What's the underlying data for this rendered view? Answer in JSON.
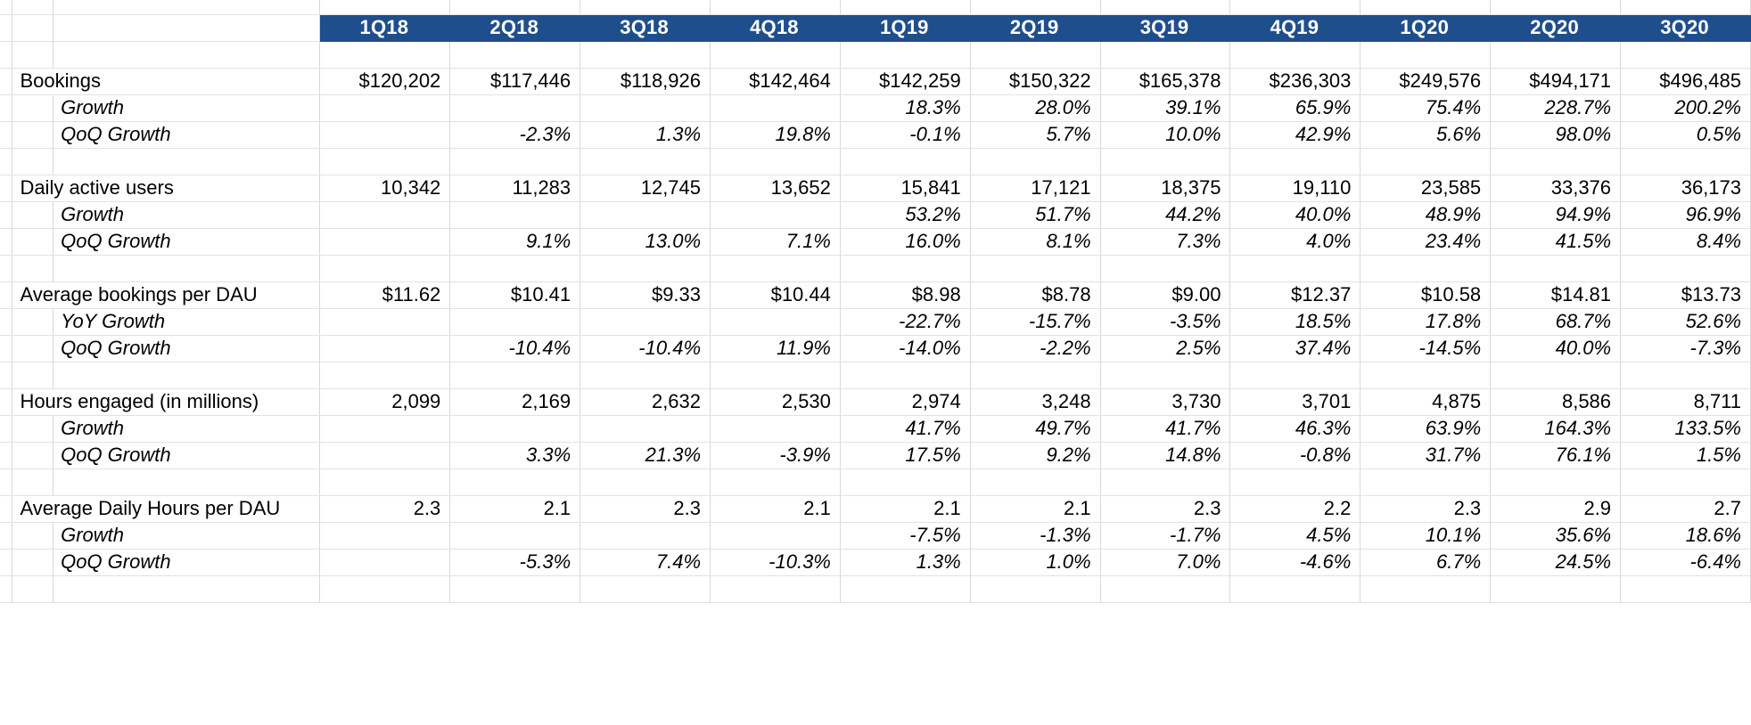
{
  "header": {
    "blank_label": "",
    "columns": [
      "1Q18",
      "2Q18",
      "3Q18",
      "4Q18",
      "1Q19",
      "2Q19",
      "3Q19",
      "4Q19",
      "1Q20",
      "2Q20",
      "3Q20"
    ],
    "background_color": "#1F4E8C",
    "text_color": "#FFFFFF"
  },
  "grid": {
    "line_color": "#D9D9D9",
    "background": "#FFFFFF"
  },
  "chart_data": {
    "type": "table",
    "title": "",
    "categories": [
      "1Q18",
      "2Q18",
      "3Q18",
      "4Q18",
      "1Q19",
      "2Q19",
      "3Q19",
      "4Q19",
      "1Q20",
      "2Q20",
      "3Q20"
    ],
    "series": [
      {
        "name": "Bookings",
        "values": [
          "$120,202",
          "$117,446",
          "$118,926",
          "$142,464",
          "$142,259",
          "$150,322",
          "$165,378",
          "$236,303",
          "$249,576",
          "$494,171",
          "$496,485"
        ]
      },
      {
        "name": "Bookings Growth",
        "values": [
          "",
          "",
          "",
          "",
          "18.3%",
          "28.0%",
          "39.1%",
          "65.9%",
          "75.4%",
          "228.7%",
          "200.2%"
        ]
      },
      {
        "name": "Bookings QoQ Growth",
        "values": [
          "",
          "-2.3%",
          "1.3%",
          "19.8%",
          "-0.1%",
          "5.7%",
          "10.0%",
          "42.9%",
          "5.6%",
          "98.0%",
          "0.5%"
        ]
      },
      {
        "name": "Daily active users",
        "values": [
          "10,342",
          "11,283",
          "12,745",
          "13,652",
          "15,841",
          "17,121",
          "18,375",
          "19,110",
          "23,585",
          "33,376",
          "36,173"
        ]
      },
      {
        "name": "Daily active users Growth",
        "values": [
          "",
          "",
          "",
          "",
          "53.2%",
          "51.7%",
          "44.2%",
          "40.0%",
          "48.9%",
          "94.9%",
          "96.9%"
        ]
      },
      {
        "name": "Daily active users QoQ Growth",
        "values": [
          "",
          "9.1%",
          "13.0%",
          "7.1%",
          "16.0%",
          "8.1%",
          "7.3%",
          "4.0%",
          "23.4%",
          "41.5%",
          "8.4%"
        ]
      },
      {
        "name": "Average bookings per DAU",
        "values": [
          "$11.62",
          "$10.41",
          "$9.33",
          "$10.44",
          "$8.98",
          "$8.78",
          "$9.00",
          "$12.37",
          "$10.58",
          "$14.81",
          "$13.73"
        ]
      },
      {
        "name": "Average bookings per DAU YoY Growth",
        "values": [
          "",
          "",
          "",
          "",
          "-22.7%",
          "-15.7%",
          "-3.5%",
          "18.5%",
          "17.8%",
          "68.7%",
          "52.6%"
        ]
      },
      {
        "name": "Average bookings per DAU QoQ Growth",
        "values": [
          "",
          "-10.4%",
          "-10.4%",
          "11.9%",
          "-14.0%",
          "-2.2%",
          "2.5%",
          "37.4%",
          "-14.5%",
          "40.0%",
          "-7.3%"
        ]
      },
      {
        "name": "Hours engaged (in millions)",
        "values": [
          "2,099",
          "2,169",
          "2,632",
          "2,530",
          "2,974",
          "3,248",
          "3,730",
          "3,701",
          "4,875",
          "8,586",
          "8,711"
        ]
      },
      {
        "name": "Hours engaged Growth",
        "values": [
          "",
          "",
          "",
          "",
          "41.7%",
          "49.7%",
          "41.7%",
          "46.3%",
          "63.9%",
          "164.3%",
          "133.5%"
        ]
      },
      {
        "name": "Hours engaged QoQ Growth",
        "values": [
          "",
          "3.3%",
          "21.3%",
          "-3.9%",
          "17.5%",
          "9.2%",
          "14.8%",
          "-0.8%",
          "31.7%",
          "76.1%",
          "1.5%"
        ]
      },
      {
        "name": "Average Daily Hours per DAU",
        "values": [
          "2.3",
          "2.1",
          "2.3",
          "2.1",
          "2.1",
          "2.1",
          "2.3",
          "2.2",
          "2.3",
          "2.9",
          "2.7"
        ]
      },
      {
        "name": "Average Daily Hours per DAU Growth",
        "values": [
          "",
          "",
          "",
          "",
          "-7.5%",
          "-1.3%",
          "-1.7%",
          "4.5%",
          "10.1%",
          "35.6%",
          "18.6%"
        ]
      },
      {
        "name": "Average Daily Hours per DAU QoQ Growth",
        "values": [
          "",
          "-5.3%",
          "7.4%",
          "-10.3%",
          "1.3%",
          "1.0%",
          "7.0%",
          "-4.6%",
          "6.7%",
          "24.5%",
          "-6.4%"
        ]
      }
    ]
  },
  "rows": [
    {
      "kind": "spacer"
    },
    {
      "kind": "main",
      "label": "Bookings",
      "values": [
        "$120,202",
        "$117,446",
        "$118,926",
        "$142,464",
        "$142,259",
        "$150,322",
        "$165,378",
        "$236,303",
        "$249,576",
        "$494,171",
        "$496,485"
      ]
    },
    {
      "kind": "sub",
      "label": "Growth",
      "values": [
        "",
        "",
        "",
        "",
        "18.3%",
        "28.0%",
        "39.1%",
        "65.9%",
        "75.4%",
        "228.7%",
        "200.2%"
      ]
    },
    {
      "kind": "sub",
      "label": "QoQ Growth",
      "values": [
        "",
        "-2.3%",
        "1.3%",
        "19.8%",
        "-0.1%",
        "5.7%",
        "10.0%",
        "42.9%",
        "5.6%",
        "98.0%",
        "0.5%"
      ]
    },
    {
      "kind": "spacer"
    },
    {
      "kind": "main",
      "label": "Daily active users",
      "values": [
        "10,342",
        "11,283",
        "12,745",
        "13,652",
        "15,841",
        "17,121",
        "18,375",
        "19,110",
        "23,585",
        "33,376",
        "36,173"
      ]
    },
    {
      "kind": "sub",
      "label": "Growth",
      "values": [
        "",
        "",
        "",
        "",
        "53.2%",
        "51.7%",
        "44.2%",
        "40.0%",
        "48.9%",
        "94.9%",
        "96.9%"
      ]
    },
    {
      "kind": "sub",
      "label": "QoQ Growth",
      "values": [
        "",
        "9.1%",
        "13.0%",
        "7.1%",
        "16.0%",
        "8.1%",
        "7.3%",
        "4.0%",
        "23.4%",
        "41.5%",
        "8.4%"
      ]
    },
    {
      "kind": "spacer"
    },
    {
      "kind": "main",
      "label": "Average bookings per DAU",
      "values": [
        "$11.62",
        "$10.41",
        "$9.33",
        "$10.44",
        "$8.98",
        "$8.78",
        "$9.00",
        "$12.37",
        "$10.58",
        "$14.81",
        "$13.73"
      ]
    },
    {
      "kind": "sub",
      "label": "YoY Growth",
      "values": [
        "",
        "",
        "",
        "",
        "-22.7%",
        "-15.7%",
        "-3.5%",
        "18.5%",
        "17.8%",
        "68.7%",
        "52.6%"
      ]
    },
    {
      "kind": "sub",
      "label": "QoQ Growth",
      "values": [
        "",
        "-10.4%",
        "-10.4%",
        "11.9%",
        "-14.0%",
        "-2.2%",
        "2.5%",
        "37.4%",
        "-14.5%",
        "40.0%",
        "-7.3%"
      ]
    },
    {
      "kind": "spacer"
    },
    {
      "kind": "main",
      "label": "Hours engaged (in millions)",
      "values": [
        "2,099",
        "2,169",
        "2,632",
        "2,530",
        "2,974",
        "3,248",
        "3,730",
        "3,701",
        "4,875",
        "8,586",
        "8,711"
      ]
    },
    {
      "kind": "sub",
      "label": "Growth",
      "values": [
        "",
        "",
        "",
        "",
        "41.7%",
        "49.7%",
        "41.7%",
        "46.3%",
        "63.9%",
        "164.3%",
        "133.5%"
      ]
    },
    {
      "kind": "sub",
      "label": "QoQ Growth",
      "values": [
        "",
        "3.3%",
        "21.3%",
        "-3.9%",
        "17.5%",
        "9.2%",
        "14.8%",
        "-0.8%",
        "31.7%",
        "76.1%",
        "1.5%"
      ]
    },
    {
      "kind": "spacer"
    },
    {
      "kind": "main",
      "label": "Average Daily Hours per DAU",
      "values": [
        "2.3",
        "2.1",
        "2.3",
        "2.1",
        "2.1",
        "2.1",
        "2.3",
        "2.2",
        "2.3",
        "2.9",
        "2.7"
      ]
    },
    {
      "kind": "sub",
      "label": "Growth",
      "values": [
        "",
        "",
        "",
        "",
        "-7.5%",
        "-1.3%",
        "-1.7%",
        "4.5%",
        "10.1%",
        "35.6%",
        "18.6%"
      ]
    },
    {
      "kind": "sub",
      "label": "QoQ Growth",
      "values": [
        "",
        "-5.3%",
        "7.4%",
        "-10.3%",
        "1.3%",
        "1.0%",
        "7.0%",
        "-4.6%",
        "6.7%",
        "24.5%",
        "-6.4%"
      ]
    },
    {
      "kind": "spacer"
    }
  ]
}
